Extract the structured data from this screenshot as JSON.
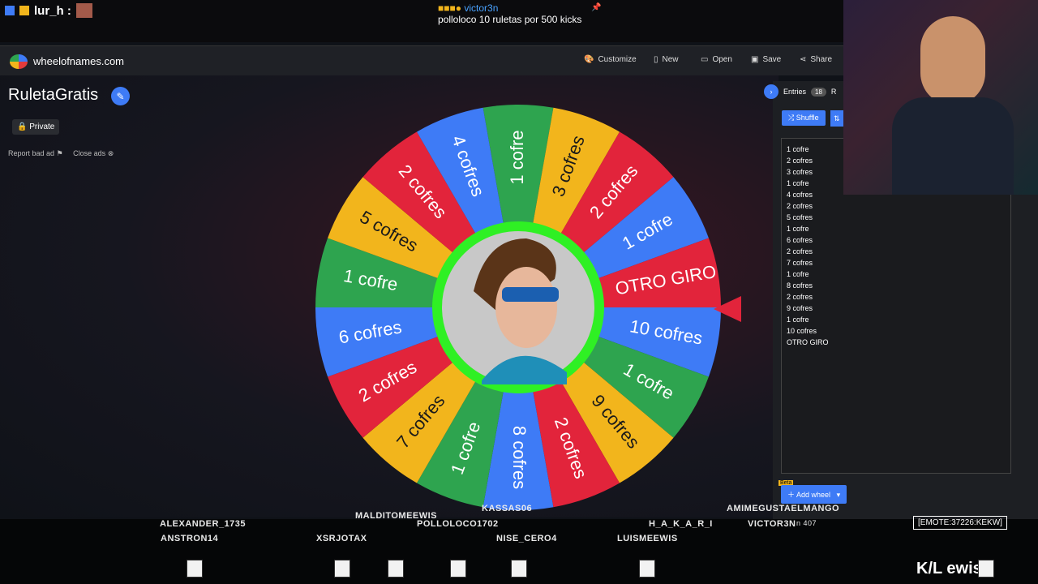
{
  "chat": {
    "user": "lur_h :",
    "notice_user": "victor3n",
    "notice_text": "polloloco 10 ruletas por 500 kicks"
  },
  "app": {
    "site": "wheelofnames.com",
    "menu": {
      "customize": "Customize",
      "new": "New",
      "open": "Open",
      "save": "Save",
      "share": "Share"
    },
    "wheel_title": "RuletaGratis",
    "private_label": "Private",
    "report_ad": "Report bad ad",
    "close_ads": "Close ads"
  },
  "sidebar": {
    "tab_entries": "Entries",
    "entries_count": "18",
    "tab_results_partial": "R",
    "shuffle": "Shuffle",
    "entries": [
      "1 cofre",
      "2 cofres",
      "3 cofres",
      "1 cofre",
      "4 cofres",
      "2 cofres",
      "5 cofres",
      "1 cofre",
      "6 cofres",
      "2 cofres",
      "7 cofres",
      "1 cofre",
      "8 cofres",
      "2 cofres",
      "9 cofres",
      "1 cofre",
      "10 cofres",
      "OTRO GIRO"
    ],
    "beta": "Beta",
    "add_wheel": "Add wheel"
  },
  "wheel": {
    "segments": [
      {
        "label": "1 cofre",
        "color": "#2ea44f"
      },
      {
        "label": "3 cofres",
        "color": "#f2b51c"
      },
      {
        "label": "2 cofres",
        "color": "#e2243b"
      },
      {
        "label": "1 cofre",
        "color": "#3e7bf6"
      },
      {
        "label": "OTRO GIRO",
        "color": "#e2243b"
      },
      {
        "label": "10 cofres",
        "color": "#3e7bf6"
      },
      {
        "label": "1 cofre",
        "color": "#2ea44f"
      },
      {
        "label": "9 cofres",
        "color": "#f2b51c"
      },
      {
        "label": "2 cofres",
        "color": "#e2243b"
      },
      {
        "label": "8 cofres",
        "color": "#3e7bf6"
      },
      {
        "label": "1 cofre",
        "color": "#2ea44f"
      },
      {
        "label": "7 cofres",
        "color": "#f2b51c"
      },
      {
        "label": "2 cofres",
        "color": "#e2243b"
      },
      {
        "label": "6 cofres",
        "color": "#3e7bf6"
      },
      {
        "label": "1 cofre",
        "color": "#2ea44f"
      },
      {
        "label": "5 cofres",
        "color": "#f2b51c"
      },
      {
        "label": "2 cofres",
        "color": "#e2243b"
      },
      {
        "label": "4 cofres",
        "color": "#3e7bf6"
      }
    ]
  },
  "viewers": {
    "n1": "ALEXANDER_1735",
    "n2": "ANSTRON14",
    "n3": "XSRJOTAX",
    "n4": "MALDITOMEEWIS",
    "n5": "POLLOLOCO1702",
    "n6": "KASSAS06",
    "n7": "NISE_CERO4",
    "n8": "LUISMEEWIS",
    "n9": "H_A_K_A_R_I",
    "n10": "AMIMEGUSTAELMANGO",
    "n11": "VICTOR3N",
    "n11b": "n 407",
    "emote": "[EMOTE:37226:KEKW]",
    "watermark": "K/L  ewis"
  }
}
